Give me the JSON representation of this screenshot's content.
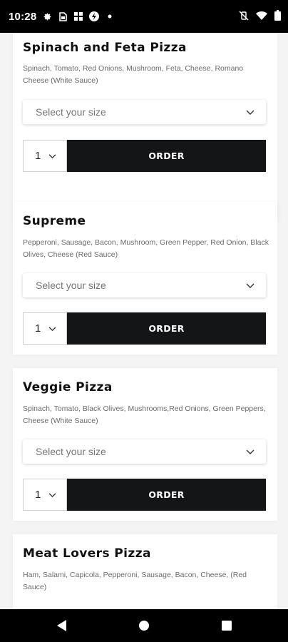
{
  "status_bar": {
    "time": "10:28",
    "left_icons": [
      "gear-icon",
      "sim-card-icon",
      "app-grid-icon",
      "data-saver-icon",
      "dot-icon"
    ],
    "right_icons": [
      "mute-vibrate-icon",
      "wifi-icon",
      "battery-icon"
    ]
  },
  "menu": {
    "items": [
      {
        "name": "Spinach and Feta Pizza",
        "description": "Spinach, Tomato, Red Onions, Mushroom, Feta, Cheese, Romano Cheese (White Sauce)",
        "size_placeholder": "Select your size",
        "quantity": "1",
        "order_label": "ORDER"
      },
      {
        "name": "Supreme",
        "description": "Pepperoni, Sausage, Bacon, Mushroom, Green Pepper, Red Onion, Black Olives, Cheese (Red Sauce)",
        "size_placeholder": "Select your size",
        "quantity": "1",
        "order_label": "ORDER"
      },
      {
        "name": "Veggie Pizza",
        "description": "Spinach, Tomato, Black Olives, Mushrooms,Red Onions, Green Peppers, Cheese (White Sauce)",
        "size_placeholder": "Select your size",
        "quantity": "1",
        "order_label": "ORDER"
      },
      {
        "name": "Meat Lovers Pizza",
        "description": "Ham, Salami, Capicola, Pepperoni, Sausage, Bacon, Cheese, (Red Sauce)"
      }
    ]
  },
  "nav_bar": {
    "buttons": [
      "back-icon",
      "home-icon",
      "recents-icon"
    ]
  }
}
